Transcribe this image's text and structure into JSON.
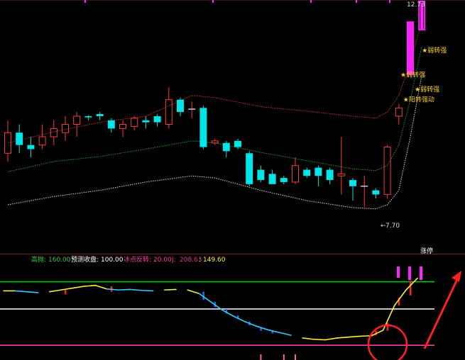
{
  "colors": {
    "background": "#000000",
    "up_candle": "#ff3b3b",
    "down_candle": "#00e5e5",
    "limit_up_candle": "#ff22ff",
    "upper_band": "#c83232",
    "middle_band": "#1f9e1f",
    "lower_band": "#dddddd",
    "annotation": "#ffd21a",
    "panel_divider": "#7a1f1f",
    "green_line": "#00cc00",
    "white_line": "#ffffff",
    "magenta_line": "#ff3ea5",
    "yellow_curve": "#ffee33",
    "cyan_curve": "#33ccff",
    "arrow": "#ff2020"
  },
  "chart_data": [
    {
      "type": "candlestick",
      "title": "",
      "price_labels": {
        "high": "12.73",
        "low": "7.70"
      },
      "candles": [
        [
          9.2,
          9.7,
          10.0,
          9.0
        ],
        [
          9.7,
          9.4,
          9.9,
          9.2
        ],
        [
          9.4,
          9.3,
          9.6,
          9.1
        ],
        [
          9.4,
          9.6,
          9.9,
          9.3
        ],
        [
          9.6,
          9.8,
          10.0,
          9.4
        ],
        [
          9.7,
          9.9,
          10.1,
          9.5
        ],
        [
          9.9,
          10.1,
          10.2,
          9.6
        ],
        [
          10.1,
          10.07,
          10.12,
          10.0
        ],
        [
          10.15,
          10.1,
          10.2,
          10.0
        ],
        [
          10.0,
          9.8,
          10.05,
          9.7
        ],
        [
          9.8,
          9.9,
          10.0,
          9.6
        ],
        [
          9.85,
          10.05,
          10.1,
          9.75
        ],
        [
          10.0,
          9.95,
          10.1,
          9.8
        ],
        [
          10.1,
          9.95,
          10.15,
          9.85
        ],
        [
          9.9,
          10.5,
          10.8,
          9.8
        ],
        [
          10.5,
          10.2,
          10.55,
          10.1
        ],
        [
          10.25,
          10.27,
          10.45,
          10.05
        ],
        [
          10.3,
          9.35,
          10.35,
          9.3
        ],
        [
          9.45,
          9.5,
          9.55,
          9.4
        ],
        [
          9.45,
          9.25,
          9.5,
          9.1
        ],
        [
          9.5,
          9.35,
          9.55,
          9.3
        ],
        [
          9.2,
          8.45,
          9.25,
          8.4
        ],
        [
          8.8,
          8.55,
          8.9,
          8.5
        ],
        [
          8.7,
          8.45,
          8.8,
          8.45
        ],
        [
          8.6,
          8.5,
          8.65,
          8.45
        ],
        [
          8.5,
          8.9,
          9.1,
          8.45
        ],
        [
          8.8,
          8.65,
          8.85,
          8.6
        ],
        [
          8.85,
          8.65,
          8.9,
          8.4
        ],
        [
          8.8,
          8.55,
          8.85,
          8.45
        ],
        [
          8.65,
          8.7,
          9.6,
          8.2
        ],
        [
          8.55,
          8.4,
          8.6,
          8.05
        ],
        [
          8.4,
          8.4,
          8.65,
          7.9
        ],
        [
          8.3,
          8.2,
          8.35,
          8.1
        ],
        [
          8.2,
          9.35,
          9.4,
          8.1
        ],
        [
          10.1,
          10.3,
          10.4,
          9.9
        ],
        [
          11.1,
          12.4,
          12.4,
          11.1
        ],
        [
          12.73,
          12.73,
          12.73,
          12.73
        ]
      ],
      "bands": {
        "upper": [
          [
            0,
            9.45
          ],
          [
            4,
            9.72
          ],
          [
            8,
            9.95
          ],
          [
            12,
            10.1
          ],
          [
            16,
            10.6
          ],
          [
            18,
            10.55
          ],
          [
            22,
            10.33
          ],
          [
            26,
            10.22
          ],
          [
            30,
            10.1
          ],
          [
            32,
            10.05
          ],
          [
            33,
            10.2
          ],
          [
            34,
            10.6
          ],
          [
            35,
            11.4
          ],
          [
            36,
            12.4
          ]
        ],
        "middle": [
          [
            0,
            8.75
          ],
          [
            4,
            9.0
          ],
          [
            8,
            9.12
          ],
          [
            12,
            9.3
          ],
          [
            16,
            9.5
          ],
          [
            18,
            9.45
          ],
          [
            22,
            9.22
          ],
          [
            26,
            9.02
          ],
          [
            30,
            8.82
          ],
          [
            32,
            8.78
          ],
          [
            33,
            8.9
          ],
          [
            34,
            9.4
          ],
          [
            35,
            10.5
          ],
          [
            36,
            11.8
          ]
        ],
        "lower": [
          [
            0,
            7.95
          ],
          [
            4,
            8.15
          ],
          [
            8,
            8.3
          ],
          [
            12,
            8.5
          ],
          [
            16,
            8.65
          ],
          [
            18,
            8.6
          ],
          [
            22,
            8.3
          ],
          [
            26,
            8.05
          ],
          [
            30,
            7.88
          ],
          [
            32,
            7.85
          ],
          [
            33,
            7.95
          ],
          [
            34,
            8.3
          ],
          [
            35,
            9.6
          ],
          [
            36,
            11.1
          ]
        ]
      },
      "annotations": [
        {
          "text": "★弱转强",
          "index": 36,
          "price": 11.65
        },
        {
          "text": "★弱转强",
          "index": 35,
          "price": 11.05
        },
        {
          "text": "★弱转强",
          "index": 35,
          "price": 10.7
        },
        {
          "text": "★阳转强动",
          "index": 34,
          "price": 10.45
        }
      ],
      "markers": [
        {
          "text": "涨停",
          "index": 36
        }
      ]
    },
    {
      "type": "line",
      "title": "",
      "legend": [
        {
          "name": "高抛",
          "value": "160.00",
          "color": "#33cc33"
        },
        {
          "name": "预测收盘",
          "value": "100.00",
          "color": "#ffffff"
        },
        {
          "name": "冰点反转",
          "value": "20.00",
          "color": "#ff3ea5"
        },
        {
          "name": "J",
          "value": "208.63",
          "color": "#dd3399"
        },
        {
          "name": "",
          "value": "149.60",
          "color": "#ffee33"
        }
      ],
      "y_range": [
        0,
        200
      ],
      "levels": [
        160,
        100,
        20
      ],
      "curve": [
        [
          0,
          140
        ],
        [
          1,
          140
        ],
        [
          2,
          138
        ],
        [
          3,
          136
        ],
        [
          4,
          138
        ],
        [
          5,
          142
        ],
        [
          6,
          146
        ],
        [
          7,
          150
        ],
        [
          8,
          152
        ],
        [
          9,
          144
        ],
        [
          10,
          142
        ],
        [
          11,
          143
        ],
        [
          12,
          141
        ],
        [
          13,
          140
        ],
        [
          14,
          142
        ],
        [
          15,
          143
        ],
        [
          16,
          142
        ],
        [
          17,
          134
        ],
        [
          18,
          116
        ],
        [
          19,
          98
        ],
        [
          20,
          84
        ],
        [
          21,
          72
        ],
        [
          22,
          62
        ],
        [
          23,
          54
        ],
        [
          24,
          48
        ],
        [
          25,
          42
        ],
        [
          26,
          36
        ],
        [
          27,
          33
        ],
        [
          28,
          32
        ],
        [
          29,
          36
        ],
        [
          30,
          38
        ],
        [
          31,
          40
        ],
        [
          32,
          41
        ],
        [
          33,
          53
        ],
        [
          34,
          108
        ],
        [
          35,
          142
        ],
        [
          36,
          168
        ]
      ],
      "cyan_segments": [
        [
          1,
          3
        ],
        [
          9,
          13
        ],
        [
          17,
          25
        ]
      ],
      "hidden_segments": [
        [
          3,
          4
        ],
        [
          13,
          14
        ],
        [
          15,
          16
        ],
        [
          25,
          26
        ]
      ]
    }
  ]
}
